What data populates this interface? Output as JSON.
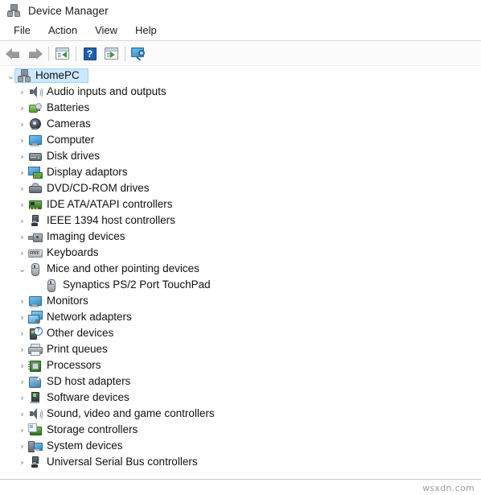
{
  "window": {
    "title": "Device Manager",
    "title_icon": "device-manager-icon"
  },
  "menubar": {
    "items": [
      {
        "label": "File"
      },
      {
        "label": "Action"
      },
      {
        "label": "View"
      },
      {
        "label": "Help"
      }
    ]
  },
  "toolbar": {
    "buttons": [
      {
        "name": "back-button",
        "icon": "back-arrow-icon",
        "label": "Back"
      },
      {
        "name": "forward-button",
        "icon": "forward-arrow-icon",
        "label": "Forward"
      },
      {
        "name": "show-hide-console-tree-button",
        "icon": "console-tree-icon",
        "label": "Show/Hide Console Tree"
      },
      {
        "name": "help-button",
        "icon": "help-question-icon",
        "label": "Help"
      },
      {
        "name": "properties-button",
        "icon": "properties-window-icon",
        "label": "Properties"
      },
      {
        "name": "scan-hardware-changes-button",
        "icon": "scan-monitor-icon",
        "label": "Scan for hardware changes"
      }
    ]
  },
  "tree": {
    "root": {
      "label": "HomePC",
      "icon": "computer-node-icon",
      "expanded": true,
      "selected": true
    },
    "nodes": [
      {
        "label": "Audio inputs and outputs",
        "icon": "speaker-icon",
        "expanded": false,
        "depth": 1
      },
      {
        "label": "Batteries",
        "icon": "battery-icon",
        "expanded": false,
        "depth": 1
      },
      {
        "label": "Cameras",
        "icon": "camera-icon",
        "expanded": false,
        "depth": 1
      },
      {
        "label": "Computer",
        "icon": "monitor-icon",
        "expanded": false,
        "depth": 1
      },
      {
        "label": "Disk drives",
        "icon": "disk-drive-icon",
        "expanded": false,
        "depth": 1
      },
      {
        "label": "Display adaptors",
        "icon": "display-adapter-icon",
        "expanded": false,
        "depth": 1
      },
      {
        "label": "DVD/CD-ROM drives",
        "icon": "dvd-drive-icon",
        "expanded": false,
        "depth": 1
      },
      {
        "label": "IDE ATA/ATAPI controllers",
        "icon": "ide-controller-icon",
        "expanded": false,
        "depth": 1
      },
      {
        "label": "IEEE 1394 host controllers",
        "icon": "firewire-plug-icon",
        "expanded": false,
        "depth": 1
      },
      {
        "label": "Imaging devices",
        "icon": "imaging-device-icon",
        "expanded": false,
        "depth": 1
      },
      {
        "label": "Keyboards",
        "icon": "keyboard-icon",
        "expanded": false,
        "depth": 1
      },
      {
        "label": "Mice and other pointing devices",
        "icon": "mouse-icon",
        "expanded": true,
        "depth": 1
      },
      {
        "label": "Synaptics PS/2 Port TouchPad",
        "icon": "mouse-icon",
        "expanded": null,
        "depth": 2
      },
      {
        "label": "Monitors",
        "icon": "monitor-icon",
        "expanded": false,
        "depth": 1
      },
      {
        "label": "Network adapters",
        "icon": "network-adapter-icon",
        "expanded": false,
        "depth": 1
      },
      {
        "label": "Other devices",
        "icon": "unknown-device-icon",
        "expanded": false,
        "depth": 1
      },
      {
        "label": "Print queues",
        "icon": "printer-icon",
        "expanded": false,
        "depth": 1
      },
      {
        "label": "Processors",
        "icon": "processor-icon",
        "expanded": false,
        "depth": 1
      },
      {
        "label": "SD host adapters",
        "icon": "sd-card-icon",
        "expanded": false,
        "depth": 1
      },
      {
        "label": "Software devices",
        "icon": "software-device-icon",
        "expanded": false,
        "depth": 1
      },
      {
        "label": "Sound, video and game controllers",
        "icon": "speaker-icon",
        "expanded": false,
        "depth": 1
      },
      {
        "label": "Storage controllers",
        "icon": "storage-controller-icon",
        "expanded": false,
        "depth": 1
      },
      {
        "label": "System devices",
        "icon": "system-device-icon",
        "expanded": false,
        "depth": 1
      },
      {
        "label": "Universal Serial Bus controllers",
        "icon": "usb-plug-icon",
        "expanded": false,
        "depth": 1
      }
    ],
    "chevron_collapsed": "›",
    "chevron_expanded": "⌄"
  },
  "watermark": {
    "text": "wsxdn.com"
  },
  "colors": {
    "selection_fill": "#cce8ff",
    "selection_border": "#99d1ff",
    "toolbar_bg": "#fbfbfb",
    "text": "#101010",
    "chevron": "#767676"
  }
}
